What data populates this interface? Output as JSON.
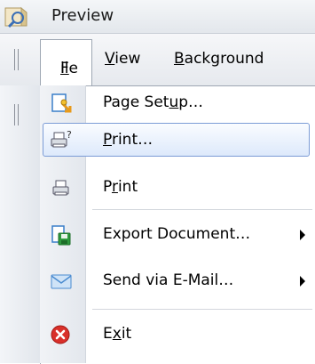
{
  "window": {
    "title": "Preview",
    "icon": "preview-app-icon"
  },
  "menubar": {
    "file": {
      "first": "F",
      "rest": "ile"
    },
    "view": {
      "first": "V",
      "rest": "iew"
    },
    "background": {
      "first": "B",
      "rest": "ackground"
    }
  },
  "file_menu": {
    "items": [
      {
        "icon": "page-setup-icon",
        "pre": "Page Set",
        "u": "u",
        "post": "p…"
      },
      {
        "icon": "print-dialog-icon",
        "pre": "",
        "u": "P",
        "post": "rint…",
        "highlighted": true
      },
      {
        "icon": "printer-icon",
        "pre": "P",
        "u": "r",
        "post": "int"
      },
      {
        "icon": "export-document-icon",
        "pre": "Export Document…",
        "u": "",
        "post": "",
        "submenu": true
      },
      {
        "icon": "email-icon",
        "pre": "Send via E-Mail…",
        "u": "",
        "post": "",
        "submenu": true
      },
      {
        "icon": "exit-icon",
        "pre": "E",
        "u": "x",
        "post": "it"
      }
    ]
  },
  "colors": {
    "highlight_border": "#7c9cd6",
    "highlight_fill": "#dde9fb",
    "exit_red": "#d9302a"
  }
}
